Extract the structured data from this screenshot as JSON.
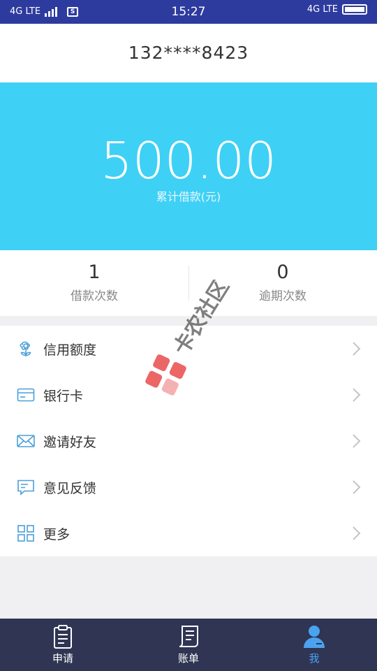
{
  "status_bar": {
    "network_left": "4G LTE",
    "time": "15:27",
    "network_right": "4G LTE",
    "sim_icon": "S"
  },
  "account": {
    "phone_masked": "132****8423"
  },
  "summary": {
    "amount": "500.00",
    "amount_label": "累计借款(元)"
  },
  "stats": [
    {
      "value": "1",
      "label": "借款次数"
    },
    {
      "value": "0",
      "label": "逾期次数"
    }
  ],
  "menu": {
    "items": [
      {
        "label": "信用额度",
        "icon": "flower-icon"
      },
      {
        "label": "银行卡",
        "icon": "credit-card-icon"
      },
      {
        "label": "邀请好友",
        "icon": "envelope-icon"
      },
      {
        "label": "意见反馈",
        "icon": "chat-bubble-icon"
      },
      {
        "label": "更多",
        "icon": "grid-icon"
      }
    ]
  },
  "tabbar": {
    "tabs": [
      {
        "label": "申请",
        "icon": "clipboard-icon",
        "active": false
      },
      {
        "label": "账单",
        "icon": "bill-icon",
        "active": false
      },
      {
        "label": "我",
        "icon": "user-icon",
        "active": true
      }
    ]
  },
  "watermark": {
    "text": "卡农社区"
  },
  "colors": {
    "status_bar": "#2e3b9e",
    "hero": "#3fd0f5",
    "tabbar": "#2f3553",
    "active_tab": "#4aa3f0",
    "menu_icon": "#4a9fd8"
  }
}
